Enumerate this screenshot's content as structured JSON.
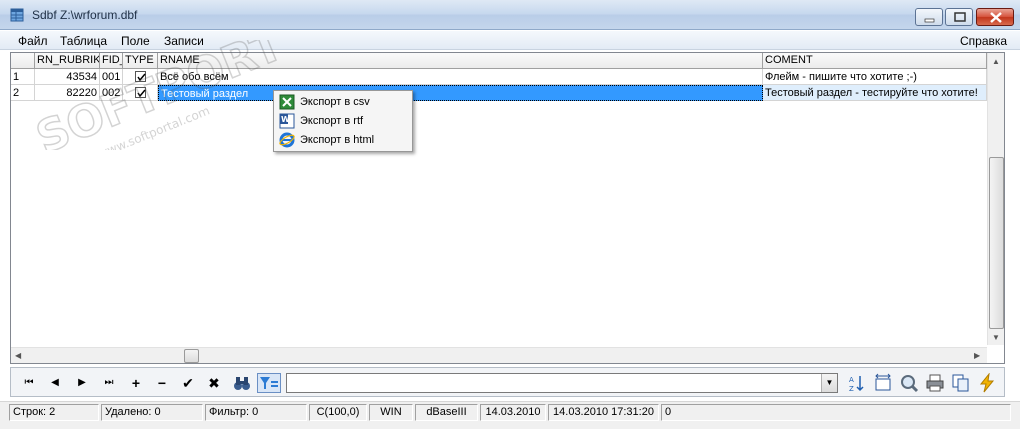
{
  "window": {
    "title": "Sdbf Z:\\wrforum.dbf"
  },
  "menu": {
    "file": "Файл",
    "table": "Таблица",
    "field": "Поле",
    "records": "Записи",
    "help": "Справка"
  },
  "grid": {
    "columns": [
      "RN_RUBRIK",
      "FID_",
      "TYPE",
      "RNAME",
      "COMENT"
    ],
    "rows": [
      {
        "num": "1",
        "rn_rubrik": "43534",
        "fid": "001",
        "type_checked": true,
        "rname": "Всё обо всём",
        "coment": "Флейм - пишите что хотите ;-)"
      },
      {
        "num": "2",
        "rn_rubrik": "82220",
        "fid": "002",
        "type_checked": true,
        "rname": "Тестовый раздел",
        "coment": "Тестовый раздел - тестируйте что хотите!"
      }
    ],
    "selected_row": 2
  },
  "context_menu": {
    "items": [
      {
        "label": "Экспорт в csv",
        "icon": "excel-icon"
      },
      {
        "label": "Экспорт в rtf",
        "icon": "word-icon"
      },
      {
        "label": "Экспорт в html",
        "icon": "ie-icon"
      }
    ]
  },
  "toolbar": {
    "filter_value": ""
  },
  "status": {
    "rows": "Строк: 2",
    "deleted": "Удалено: 0",
    "filter": "Фильтр: 0",
    "field_type": "C(100,0)",
    "codepage": "WIN",
    "format": "dBaseIII",
    "date": "14.03.2010",
    "datetime": "14.03.2010 17:31:20",
    "extra": "0"
  },
  "watermark": {
    "text": "SOFTPORTAL",
    "url": "www.softportal.com"
  },
  "colors": {
    "selection": "#3399ff",
    "title_gradient": "#c6d8ee",
    "close_button": "#c2361c"
  }
}
